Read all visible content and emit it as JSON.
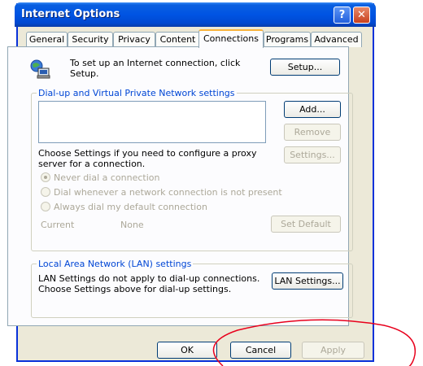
{
  "window": {
    "title": "Internet Options"
  },
  "titlebar": {
    "help_icon": "question-mark",
    "help_glyph": "?",
    "close_icon": "x",
    "close_glyph": "✕"
  },
  "tabs": [
    "General",
    "Security",
    "Privacy",
    "Content",
    "Connections",
    "Programs",
    "Advanced"
  ],
  "active_tab": "Connections",
  "setup": {
    "text": "To set up an Internet connection, click Setup.",
    "button": "Setup..."
  },
  "dialup": {
    "group_title": "Dial-up and Virtual Private Network settings",
    "add": "Add...",
    "remove": "Remove",
    "settings": "Settings...",
    "proxy_text": "Choose Settings if you need to configure a proxy server for a connection.",
    "radios": [
      "Never dial a connection",
      "Dial whenever a network connection is not present",
      "Always dial my default connection"
    ],
    "selected_radio": 0,
    "current_label": "Current",
    "current_value": "None",
    "set_default": "Set Default"
  },
  "lan": {
    "group_title": "Local Area Network (LAN) settings",
    "text": "LAN Settings do not apply to dial-up connections. Choose Settings above for dial-up settings.",
    "button": "LAN Settings..."
  },
  "footer": {
    "ok": "OK",
    "cancel": "Cancel",
    "apply": "Apply"
  },
  "colors": {
    "annotation": "#e8001c",
    "title_bar": "#0054e3",
    "group_title": "#0046d5"
  }
}
